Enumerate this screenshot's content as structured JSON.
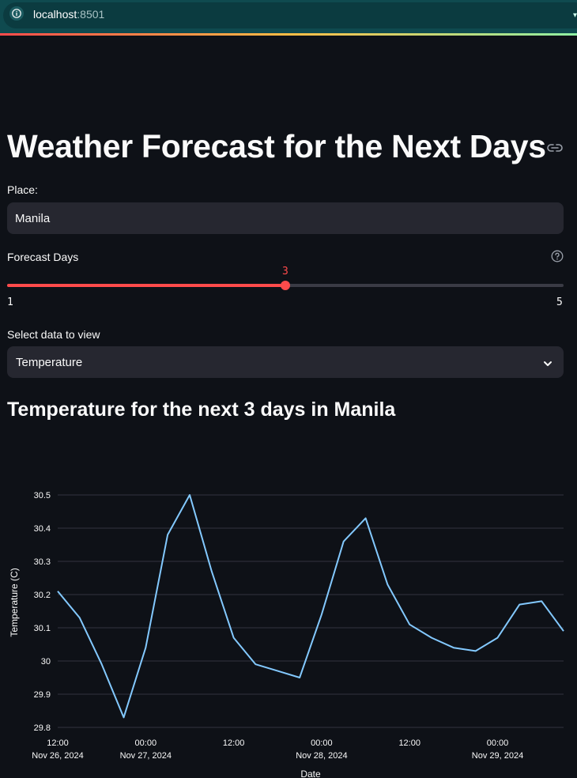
{
  "browser": {
    "host": "localhost",
    "port": ":8501"
  },
  "page": {
    "title": "Weather Forecast for the Next Days",
    "place_label": "Place:",
    "place_value": "Manila",
    "forecast_label": "Forecast Days",
    "slider": {
      "min": 1,
      "max": 5,
      "value": 3,
      "min_label": "1",
      "max_label": "5",
      "value_label": "3"
    },
    "select_label": "Select data to view",
    "select_value": "Temperature",
    "subtitle": "Temperature for the next 3 days in Manila"
  },
  "colors": {
    "accent": "#ff4b4b",
    "line": "#83c9ff",
    "background": "#0e1117",
    "input_bg": "#262730"
  },
  "chart_data": {
    "type": "line",
    "xlabel": "Date",
    "ylabel": "Temperature (C)",
    "ylim": [
      29.8,
      30.5
    ],
    "y_ticks": [
      "29.8",
      "29.9",
      "30",
      "30.1",
      "30.2",
      "30.3",
      "30.4",
      "30.5"
    ],
    "x_ticks": [
      {
        "time": "12:00",
        "date": "Nov 26, 2024",
        "hours": 0
      },
      {
        "time": "00:00",
        "date": "Nov 27, 2024",
        "hours": 12
      },
      {
        "time": "12:00",
        "date": "",
        "hours": 24
      },
      {
        "time": "00:00",
        "date": "Nov 28, 2024",
        "hours": 36
      },
      {
        "time": "12:00",
        "date": "",
        "hours": 48
      },
      {
        "time": "00:00",
        "date": "Nov 29, 2024",
        "hours": 60
      }
    ],
    "x_hours": [
      0,
      3,
      6,
      9,
      12,
      15,
      18,
      21,
      24,
      27,
      30,
      33,
      36,
      39,
      42,
      45,
      48,
      51,
      54,
      57,
      60,
      63,
      66,
      69
    ],
    "values": [
      30.21,
      30.13,
      29.99,
      29.83,
      30.04,
      30.38,
      30.5,
      30.27,
      30.07,
      29.99,
      29.97,
      29.95,
      30.14,
      30.36,
      30.43,
      30.23,
      30.11,
      30.07,
      30.04,
      30.03,
      30.07,
      30.17,
      30.18,
      30.09
    ],
    "grid": true
  }
}
